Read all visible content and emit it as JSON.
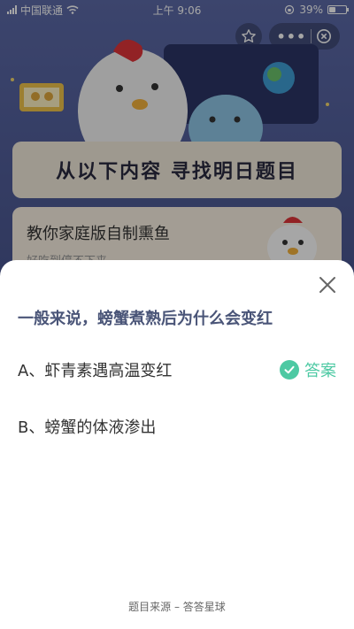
{
  "status_bar": {
    "carrier": "中国联通",
    "time": "上午 9:06",
    "battery": "39%",
    "battery_level": 0.39
  },
  "background": {
    "banner_title": "从以下内容 寻找明日题目",
    "article_title": "教你家庭版自制熏鱼",
    "article_subtitle": "好吃到停不下来"
  },
  "sheet": {
    "question": "一般来说，螃蟹煮熟后为什么会变红",
    "options": [
      {
        "text": "A、虾青素遇高温变红",
        "answer_label": "答案"
      },
      {
        "text": "B、螃蟹的体液渗出"
      }
    ],
    "source": "题目来源 – 答答星球"
  },
  "colors": {
    "accent": "#4dc9a3",
    "question": "#4a5578"
  }
}
